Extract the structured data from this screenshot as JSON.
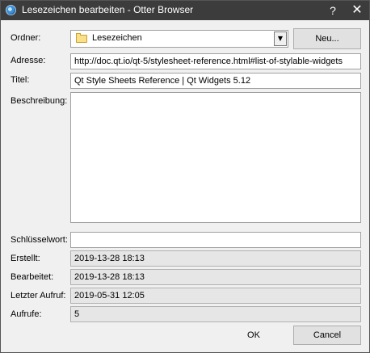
{
  "window": {
    "title": "Lesezeichen bearbeiten - Otter Browser",
    "help_label": "?",
    "close_label": "✕"
  },
  "form": {
    "folder_label": "Ordner:",
    "folder_value": "Lesezeichen",
    "new_button": "Neu...",
    "address_label": "Adresse:",
    "address_value": "http://doc.qt.io/qt-5/stylesheet-reference.html#list-of-stylable-widgets",
    "title_label": "Titel:",
    "title_value": "Qt Style Sheets Reference | Qt Widgets 5.12",
    "description_label": "Beschreibung:",
    "description_value": "",
    "keyword_label": "Schlüsselwort:",
    "keyword_value": "",
    "created_label": "Erstellt:",
    "created_value": "2019-13-28 18:13",
    "modified_label": "Bearbeitet:",
    "modified_value": "2019-13-28 18:13",
    "last_visit_label": "Letzter Aufruf:",
    "last_visit_value": "2019-05-31 12:05",
    "visits_label": "Aufrufe:",
    "visits_value": "5"
  },
  "buttons": {
    "ok": "OK",
    "cancel": "Cancel"
  },
  "icons": {
    "app": "otter-browser-icon",
    "folder": "folder-icon",
    "dropdown": "chevron-down-icon"
  }
}
